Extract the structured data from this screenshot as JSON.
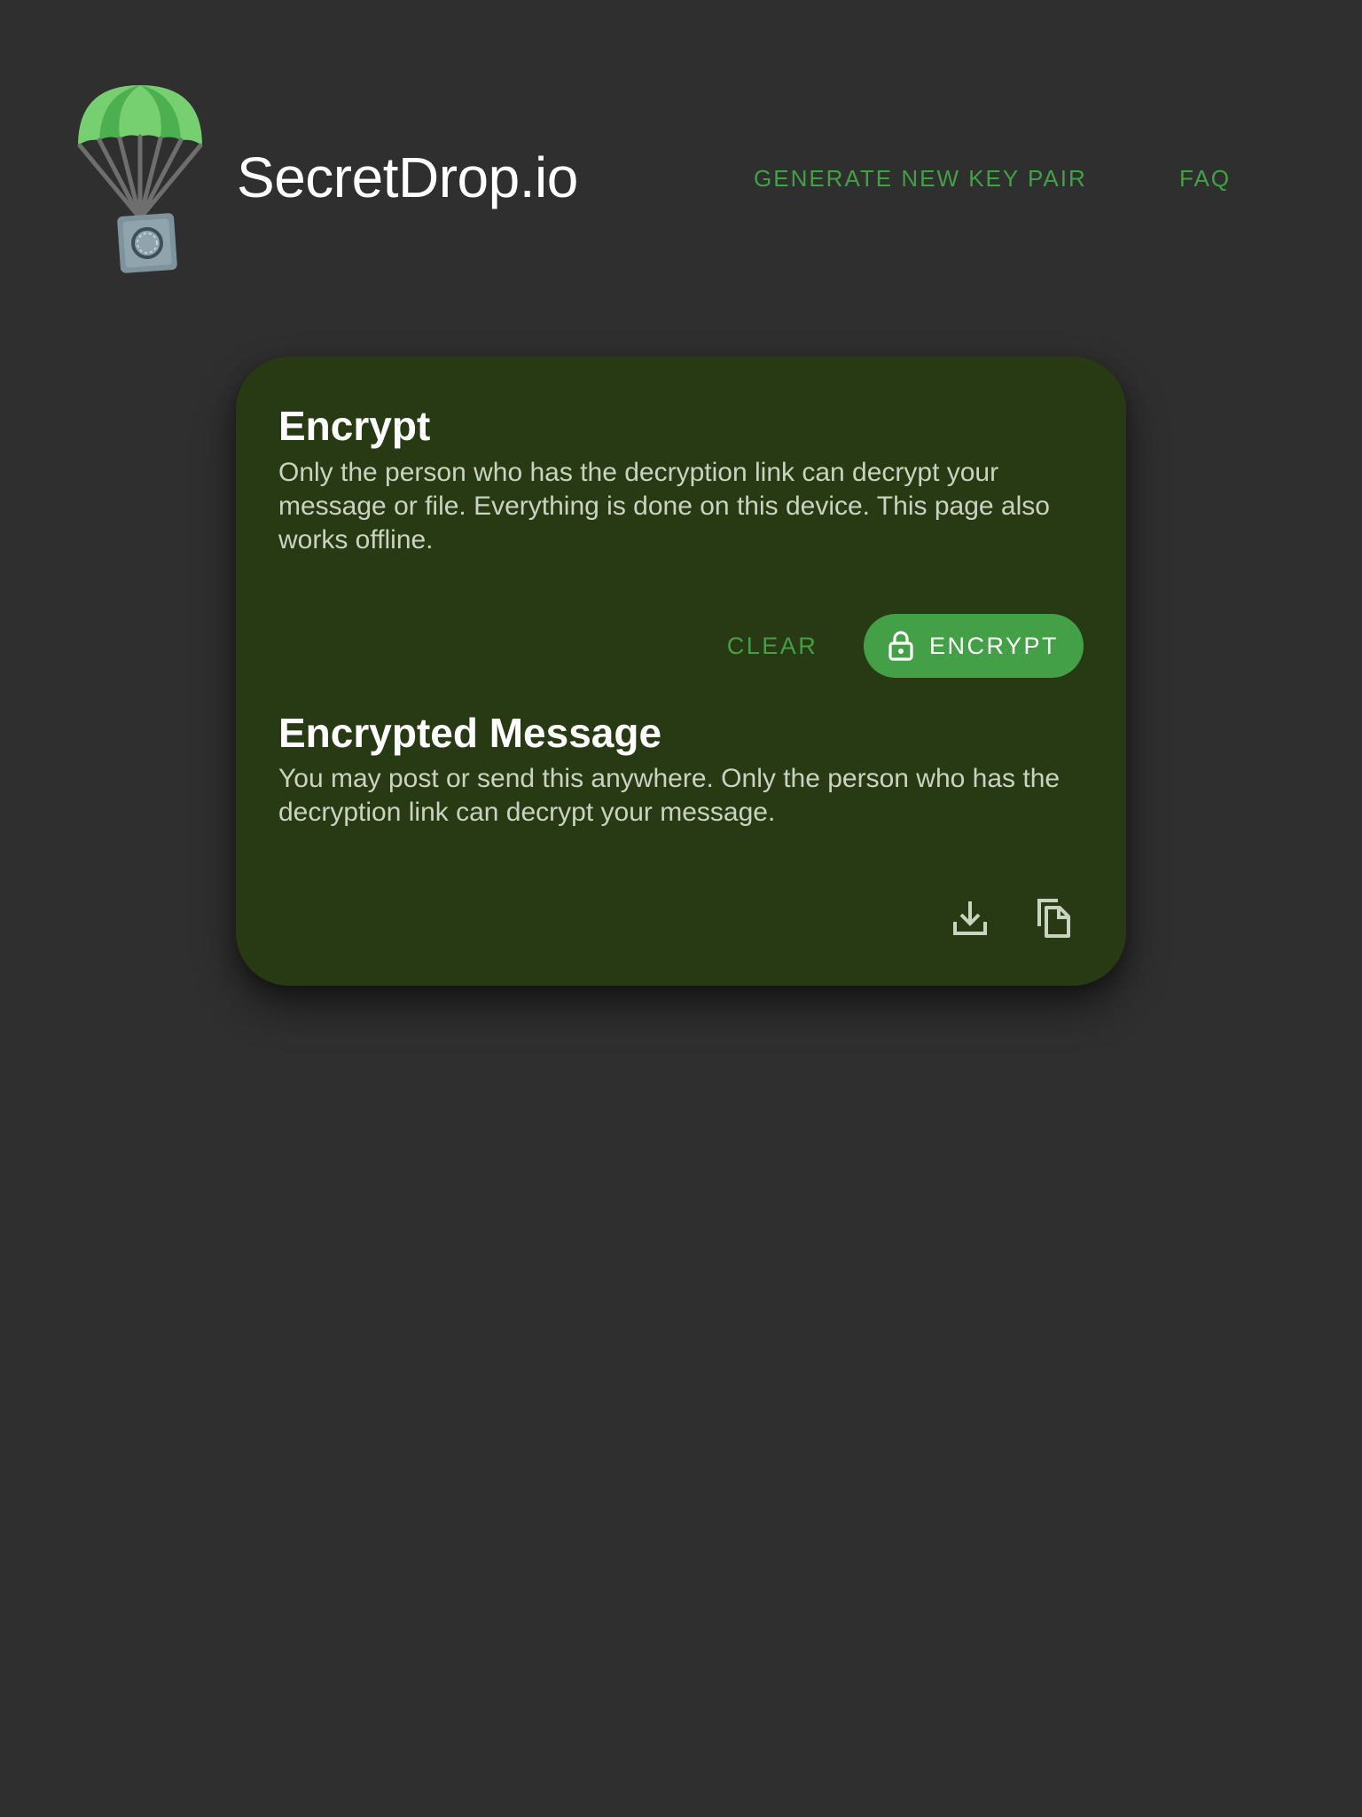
{
  "header": {
    "brand": "SecretDrop.io",
    "nav": [
      {
        "label": "GENERATE NEW KEY PAIR"
      },
      {
        "label": "FAQ"
      }
    ]
  },
  "encrypt_section": {
    "title": "Encrypt",
    "description": "Only the person who has the decryption link can decrypt your message or file. Everything is done on this device. This page also works offline.",
    "clear_label": "CLEAR",
    "encrypt_label": "ENCRYPT"
  },
  "encrypted_section": {
    "title": "Encrypted Message",
    "description": "You may post or send this anywhere. Only the person who has the decryption link can decrypt your message."
  },
  "icons": {
    "logo": "parachute-safe-icon",
    "encrypt_button": "lock-icon",
    "download": "download-icon",
    "copy": "copy-icon"
  },
  "colors": {
    "background": "#2f2f2f",
    "card": "#283a13",
    "accent": "#43a047",
    "text": "#ffffff",
    "muted_text": "#c9d4c0"
  }
}
